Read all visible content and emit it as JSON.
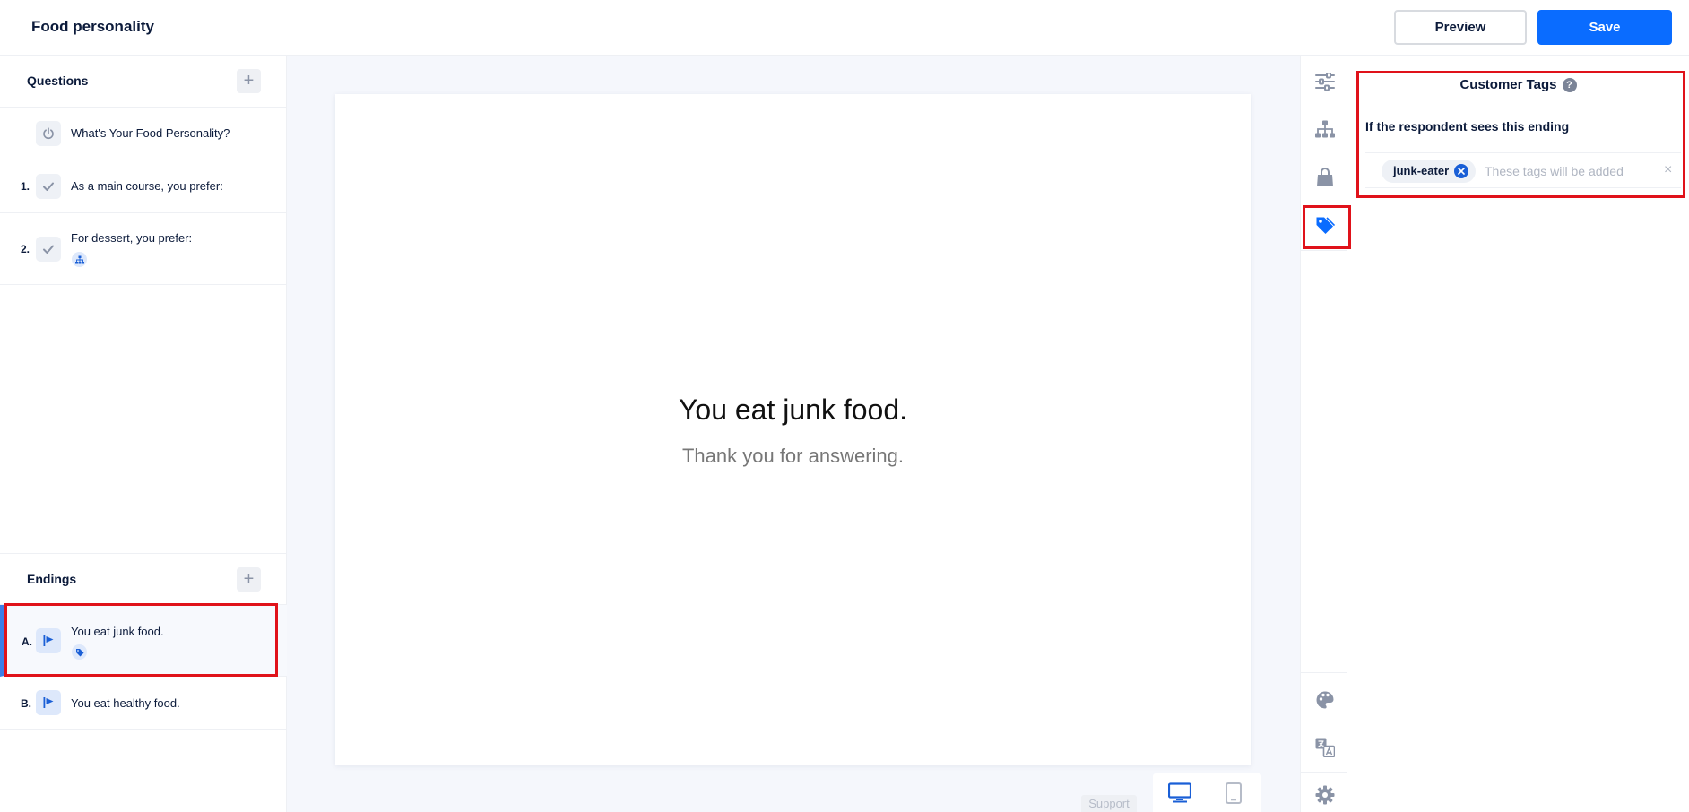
{
  "header": {
    "title": "Food personality",
    "preview_label": "Preview",
    "save_label": "Save"
  },
  "questions": {
    "title": "Questions",
    "add_label": "+",
    "items": [
      {
        "num": "",
        "label": "What's Your Food Personality?",
        "icon": "power-icon"
      },
      {
        "num": "1.",
        "label": "As a main course, you prefer:",
        "icon": "check-icon"
      },
      {
        "num": "2.",
        "label": "For dessert, you prefer:",
        "icon": "check-icon",
        "badge": "sitemap-icon"
      }
    ]
  },
  "endings": {
    "title": "Endings",
    "add_label": "+",
    "items": [
      {
        "num": "A.",
        "label": "You eat junk food.",
        "icon": "flag-icon",
        "badge": "tag-icon",
        "selected": true
      },
      {
        "num": "B.",
        "label": "You eat healthy food.",
        "icon": "flag-icon"
      }
    ]
  },
  "preview": {
    "title": "You eat junk food.",
    "subtitle": "Thank you for answering.",
    "support_label": "Support"
  },
  "rail": {
    "top": [
      "sliders-icon",
      "sitemap-icon",
      "shopping-bag-icon",
      "tag-icon"
    ],
    "bottom": [
      "palette-icon",
      "translate-icon",
      "gear-icon"
    ],
    "active": "tag-icon"
  },
  "panel": {
    "title": "Customer Tags",
    "help": "?",
    "label": "If the respondent sees this ending",
    "tags": [
      "junk-eater"
    ],
    "placeholder": "These tags will be added",
    "clear": "×"
  },
  "colors": {
    "accent": "#0a6cff",
    "highlight": "#e0121a",
    "icon_gray": "#8a93a6",
    "text_dark": "#0b1a3a"
  }
}
